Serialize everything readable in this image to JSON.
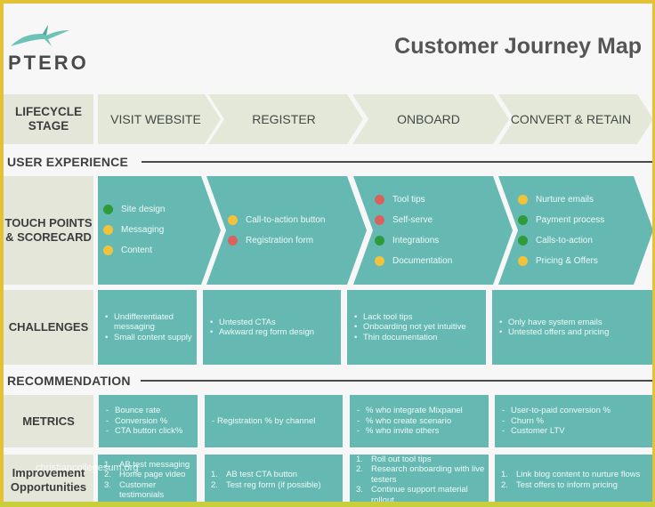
{
  "header": {
    "brand": "PTERO",
    "title": "Customer Journey Map",
    "logo_icon": "pterodactyl-bird-icon"
  },
  "colors": {
    "frame": "#e3c237",
    "background": "#f7f7f7",
    "label_cell": "#e4e6da",
    "teal": "#66b9b3",
    "stage_arrow": "#e4e8d9",
    "status_green": "#2e9a3a",
    "status_yellow": "#f2c33a",
    "status_red": "#d9625f"
  },
  "lifecycle": {
    "label": "LIFECYCLE STAGE",
    "stages": [
      "VISIT WEBSITE",
      "REGISTER",
      "ONBOARD",
      "CONVERT & RETAIN"
    ]
  },
  "sections": {
    "user_experience": "USER EXPERIENCE",
    "recommendation": "RECOMMENDATION"
  },
  "touch_points": {
    "label": "TOUCH POINTS & SCORECARD",
    "columns": [
      [
        {
          "text": "Site design",
          "status": "green"
        },
        {
          "text": "Messaging",
          "status": "yellow"
        },
        {
          "text": "Content",
          "status": "yellow"
        }
      ],
      [
        {
          "text": "Call-to-action button",
          "status": "yellow"
        },
        {
          "text": "Registration form",
          "status": "red"
        }
      ],
      [
        {
          "text": "Tool tips",
          "status": "red"
        },
        {
          "text": "Self-serve",
          "status": "red"
        },
        {
          "text": "Integrations",
          "status": "green"
        },
        {
          "text": "Documentation",
          "status": "yellow"
        }
      ],
      [
        {
          "text": "Nurture emails",
          "status": "yellow"
        },
        {
          "text": "Payment process",
          "status": "green"
        },
        {
          "text": "Calls-to-action",
          "status": "green"
        },
        {
          "text": "Pricing & Offers",
          "status": "yellow"
        }
      ]
    ]
  },
  "challenges": {
    "label": "CHALLENGES",
    "marker": "•",
    "columns": [
      [
        "Undifferentiated messaging",
        "Small content supply"
      ],
      [
        "Untested CTAs",
        "Awkward reg form design"
      ],
      [
        "Lack tool tips",
        "Onboarding not yet intuitive",
        "Thin documentation"
      ],
      [
        "Only have system emails",
        "Untested offers and pricing"
      ]
    ]
  },
  "metrics": {
    "label": "METRICS",
    "marker": "-",
    "columns": [
      [
        "Bounce rate",
        "Conversion %",
        "CTA button click%"
      ],
      [
        "Registration % by channel"
      ],
      [
        "% who integrate Mixpanel",
        "% who create scenario",
        "% who invite others"
      ],
      [
        "User-to-paid conversion %",
        "Churn %",
        "Customer LTV"
      ]
    ]
  },
  "improvements": {
    "label": "Improvement Opportunities",
    "columns": [
      [
        "AB test messaging",
        "Home page video",
        "Customer testimonials"
      ],
      [
        "AB test CTA button",
        "Test reg form (if possible)"
      ],
      [
        "Roll out tool tips",
        "Research onboarding with live testers",
        "Continue support material rollout"
      ],
      [
        "Link blog content to nurture flows",
        "Test offers to inform pricing"
      ]
    ]
  },
  "watermark": "christiancollegesum.org"
}
